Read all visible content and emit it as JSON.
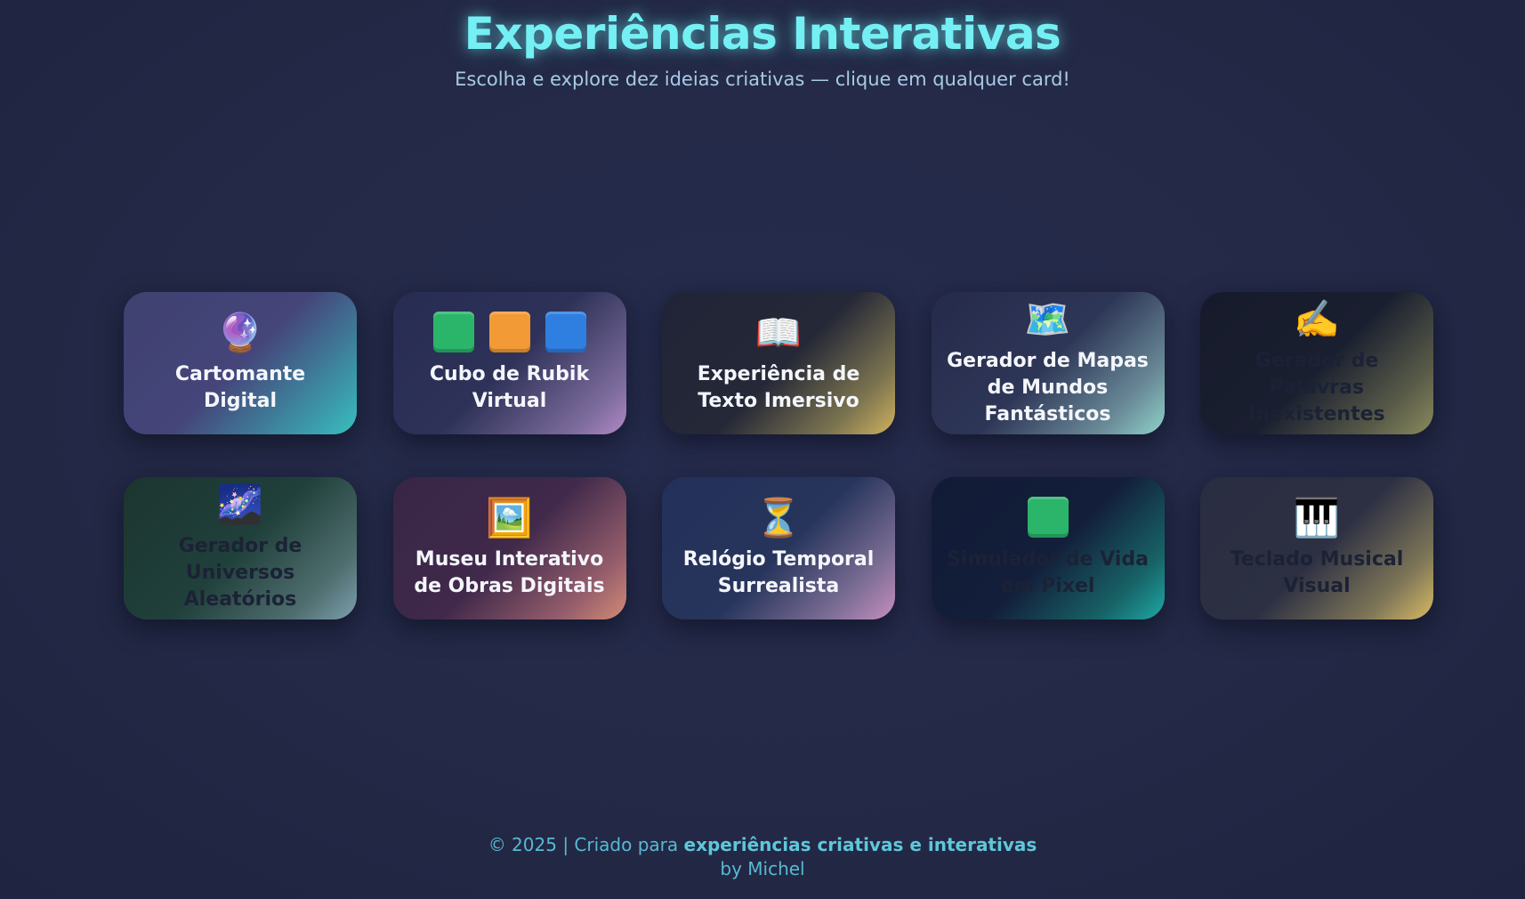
{
  "header": {
    "title": "Experiências Interativas",
    "subtitle": "Escolha e explore dez ideias criativas — clique em qualquer card!"
  },
  "cards": [
    {
      "title": "Cartomante Digital",
      "icon": "crystal-ball-icon",
      "glyph": "🔮"
    },
    {
      "title": "Cubo de Rubik Virtual",
      "icon": "rubik-cubes-icon",
      "glyph": ""
    },
    {
      "title": "Experiência de Texto Imersivo",
      "icon": "open-book-icon",
      "glyph": "📖"
    },
    {
      "title": "Gerador de Mapas de Mundos Fantásticos",
      "icon": "world-map-icon",
      "glyph": "🗺️"
    },
    {
      "title": "Gerador de Palavras Inexistentes",
      "icon": "writing-hand-icon",
      "glyph": "✍️"
    },
    {
      "title": "Gerador de Universos Aleatórios",
      "icon": "milky-way-icon",
      "glyph": "🌌"
    },
    {
      "title": "Museu Interativo de Obras Digitais",
      "icon": "framed-picture-icon",
      "glyph": "🖼️"
    },
    {
      "title": "Relógio Temporal Surrealista",
      "icon": "hourglass-icon",
      "glyph": "⏳"
    },
    {
      "title": "Simulador de Vida em Pixel",
      "icon": "green-square-icon",
      "glyph": ""
    },
    {
      "title": "Teclado Musical Visual",
      "icon": "piano-keys-icon",
      "glyph": "🎹"
    }
  ],
  "footer": {
    "prefix": "© 2025 | Criado para ",
    "highlight": "experiências criativas e interativas",
    "byline": "by Michel"
  },
  "colors": {
    "title": "#74f0f4",
    "subtitle": "#a8cbe6",
    "background": "#232946",
    "footer_text": "#58b9d2"
  }
}
